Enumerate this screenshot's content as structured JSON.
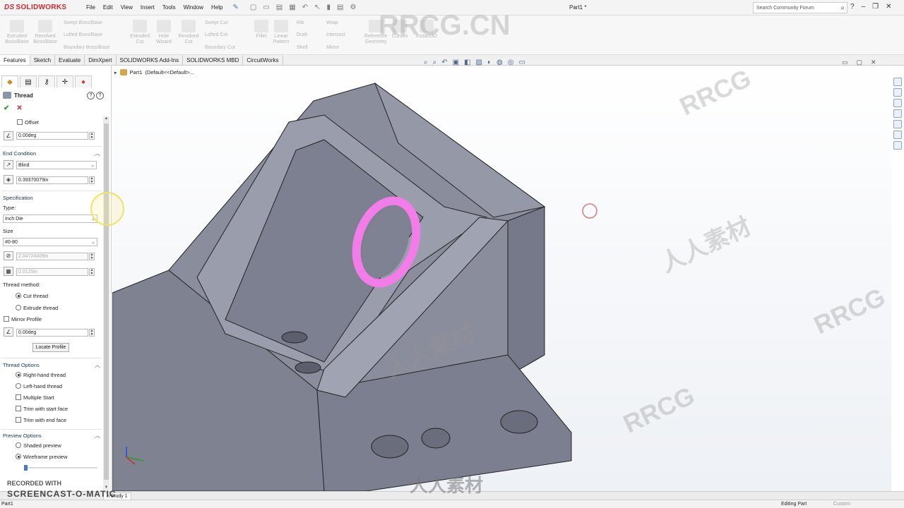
{
  "app": {
    "logo": "SOLIDWORKS",
    "logo_prefix": "DS",
    "menu": [
      "File",
      "Edit",
      "View",
      "Insert",
      "Tools",
      "Window",
      "Help"
    ],
    "document_title": "Part1 *",
    "search_placeholder": "Search Community Forum",
    "help_menu": "?"
  },
  "ribbon": {
    "items": [
      {
        "label": "Extruded Boss/Base",
        "icon": "extruded-boss-icon"
      },
      {
        "label": "Revolved Boss/Base",
        "icon": "revolved-boss-icon"
      },
      {
        "label": "Swept Boss/Base",
        "icon": "swept-boss-icon"
      },
      {
        "label": "Lofted Boss/Base",
        "icon": "lofted-boss-icon"
      },
      {
        "label": "Boundary Boss/Base",
        "icon": "boundary-boss-icon"
      },
      {
        "label": "Extruded Cut",
        "icon": "extruded-cut-icon"
      },
      {
        "label": "Hole Wizard",
        "icon": "hole-wizard-icon"
      },
      {
        "label": "Revolved Cut",
        "icon": "revolved-cut-icon"
      },
      {
        "label": "Swept Cut",
        "icon": "swept-cut-icon"
      },
      {
        "label": "Lofted Cut",
        "icon": "lofted-cut-icon"
      },
      {
        "label": "Boundary Cut",
        "icon": "boundary-cut-icon"
      },
      {
        "label": "Fillet",
        "icon": "fillet-icon"
      },
      {
        "label": "Linear Pattern",
        "icon": "linear-pattern-icon"
      },
      {
        "label": "Rib",
        "icon": "rib-icon"
      },
      {
        "label": "Draft",
        "icon": "draft-icon"
      },
      {
        "label": "Shell",
        "icon": "shell-icon"
      },
      {
        "label": "Wrap",
        "icon": "wrap-icon"
      },
      {
        "label": "Intersect",
        "icon": "intersect-icon"
      },
      {
        "label": "Mirror",
        "icon": "mirror-icon"
      },
      {
        "label": "Reference Geometry",
        "icon": "reference-geometry-icon"
      },
      {
        "label": "Curves",
        "icon": "curves-icon"
      },
      {
        "label": "Instant3D",
        "icon": "instant3d-icon"
      }
    ]
  },
  "tabs": [
    "Features",
    "Sketch",
    "Evaluate",
    "DimXpert",
    "SOLIDWORKS Add-Ins",
    "SOLIDWORKS MBD",
    "CircuitWorks"
  ],
  "property_manager": {
    "title": "Thread",
    "offset_label": "Offset",
    "offset_angle": "0.00deg",
    "end_condition": {
      "header": "End Condition",
      "type": "Blind",
      "depth": "0.39370079in"
    },
    "specification": {
      "header": "Specification",
      "type_label": "Type:",
      "type_value": "Inch Die",
      "size_label": "Size",
      "size_value": "#0-80",
      "diameter": "2.04724409in",
      "pitch": "0.0125in",
      "method_label": "Thread method:",
      "cut_thread": "Cut thread",
      "extrude_thread": "Extrude thread",
      "mirror_profile": "Mirror Profile",
      "profile_angle": "0.00deg",
      "locate_profile": "Locate Profile"
    },
    "thread_options": {
      "header": "Thread Options",
      "right_hand": "Right-hand thread",
      "left_hand": "Left-hand thread",
      "multiple_start": "Multiple Start",
      "trim_start": "Trim with start face",
      "trim_end": "Trim with end face"
    },
    "preview_options": {
      "header": "Preview Options",
      "shaded": "Shaded preview",
      "wireframe": "Wireframe preview"
    }
  },
  "tree": {
    "part": "Part1",
    "config": "(Default<<Default>..."
  },
  "bottom": {
    "tab_fragment": "n Study 1",
    "recorded": "RECORDED WITH",
    "screencast": "SCREENCAST-O-MATIC"
  },
  "status": {
    "left": "Part1",
    "mid": "Editing Part",
    "right": "Custom"
  },
  "watermarks": {
    "main": "RRCG.CN",
    "rrcg": "RRCG",
    "cn": "人人素材"
  },
  "colors": {
    "accent": "#d6272d",
    "model": "#8a8d9c",
    "thread_highlight": "#f27ce8"
  }
}
